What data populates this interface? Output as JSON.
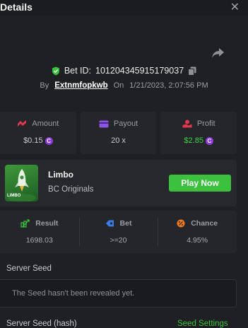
{
  "header": {
    "title": "Details",
    "close_icon": "close-icon"
  },
  "bet": {
    "id_label": "Bet ID:",
    "id_value": "101204345915179037",
    "by_label": "By",
    "username": "Extnmfopkwb",
    "on_label": "On",
    "datetime": "1/21/2023, 2:07:56 PM"
  },
  "stats": {
    "amount": {
      "label": "Amount",
      "value": "$0.15",
      "icon": "amount-icon"
    },
    "payout": {
      "label": "Payout",
      "value": "20 x",
      "icon": "payout-icon"
    },
    "profit": {
      "label": "Profit",
      "value": "$2.85",
      "icon": "profit-icon"
    }
  },
  "game": {
    "name": "Limbo",
    "provider": "BC Originals",
    "thumb_text": "LIMBO",
    "play_label": "Play Now"
  },
  "details": {
    "result": {
      "label": "Result",
      "value": "1698.03"
    },
    "bet": {
      "label": "Bet",
      "value": ">=20"
    },
    "chance": {
      "label": "Chance",
      "value": "4.95%"
    }
  },
  "seeds": {
    "server_seed_label": "Server Seed",
    "server_seed_text": "The Seed hasn't been revealed yet.",
    "server_seed_hash_label": "Server Seed (hash)",
    "seed_settings_label": "Seed Settings"
  },
  "colors": {
    "accent_green": "#3bc13d",
    "profit_green": "#3fd14a",
    "coin_purple": "#8d3bdd",
    "background": "#1e2023",
    "card": "#24262a"
  }
}
